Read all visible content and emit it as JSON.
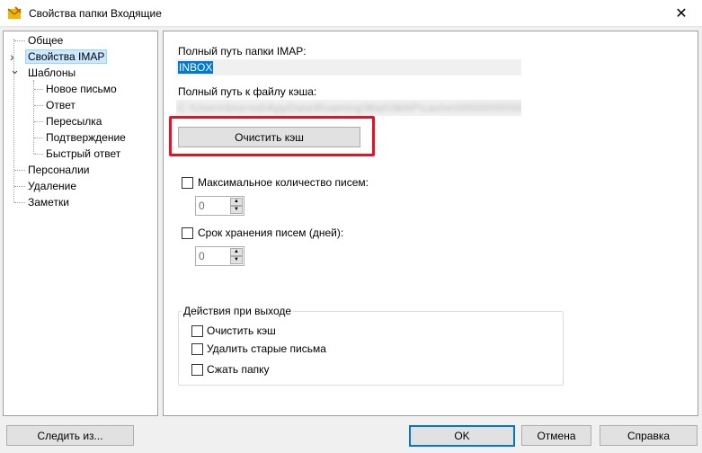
{
  "window": {
    "title": "Свойства папки Входящие",
    "close_glyph": "✕"
  },
  "tree": {
    "items": [
      {
        "label": "Общее"
      },
      {
        "label": "Свойства IMAP"
      },
      {
        "label": "Шаблоны"
      },
      {
        "label": "Новое письмо"
      },
      {
        "label": "Ответ"
      },
      {
        "label": "Пересылка"
      },
      {
        "label": "Подтверждение"
      },
      {
        "label": "Быстрый ответ"
      },
      {
        "label": "Персоналии"
      },
      {
        "label": "Удаление"
      },
      {
        "label": "Заметки"
      }
    ],
    "collapsed_glyph": "›",
    "expanded_glyph": "⌄"
  },
  "imap": {
    "path_label": "Полный путь папки IMAP:",
    "path_value": "INBOX",
    "cache_path_label": "Полный путь к файлу кэша:",
    "cache_path_value": "C:\\Users\\blurred\\AppData\\Roaming\\Mail\\IMAP\\cache\\0000000000000000000",
    "clear_cache_button": "Очистить кэш"
  },
  "limits": {
    "max_messages_label": "Максимальное количество писем:",
    "max_messages_value": "0",
    "retention_label": "Срок хранения писем (дней):",
    "retention_value": "0"
  },
  "exit_actions": {
    "title": "Действия при выходе",
    "clear_cache": "Очистить кэш",
    "delete_old": "Удалить старые письма",
    "compress": "Сжать папку"
  },
  "footer": {
    "follow_button": "Следить из...",
    "ok_button": "OK",
    "cancel_button": "Отмена",
    "help_button": "Справка"
  },
  "colors": {
    "accent": "#0078d7",
    "highlight": "#e81123",
    "selection": "#cce8ff"
  }
}
